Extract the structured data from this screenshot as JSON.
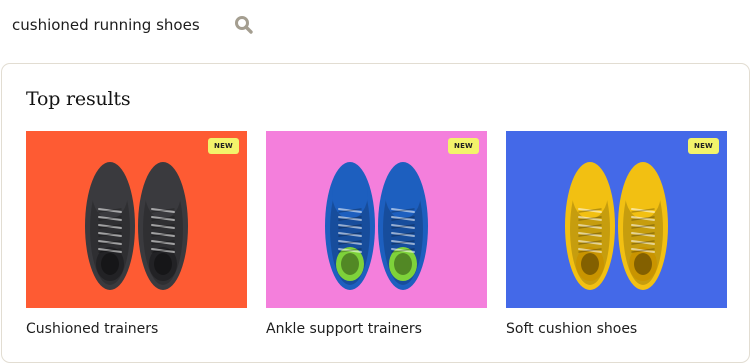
{
  "search": {
    "value": "cushioned running shoes",
    "icon": "search-icon"
  },
  "results": {
    "title": "Top results",
    "cards": [
      {
        "label": "Cushioned trainers",
        "badge": "NEW",
        "background": "#fe5b33",
        "shoe_color": "#3a3a3e",
        "accent": "#222225"
      },
      {
        "label": "Ankle support trainers",
        "badge": "NEW",
        "background": "#f47fdc",
        "shoe_color": "#1d5fbf",
        "accent": "#7ed23a"
      },
      {
        "label": "Soft cushion shoes",
        "badge": "NEW",
        "background": "#4469e8",
        "shoe_color": "#f2c012",
        "accent": "#c99400"
      }
    ]
  }
}
